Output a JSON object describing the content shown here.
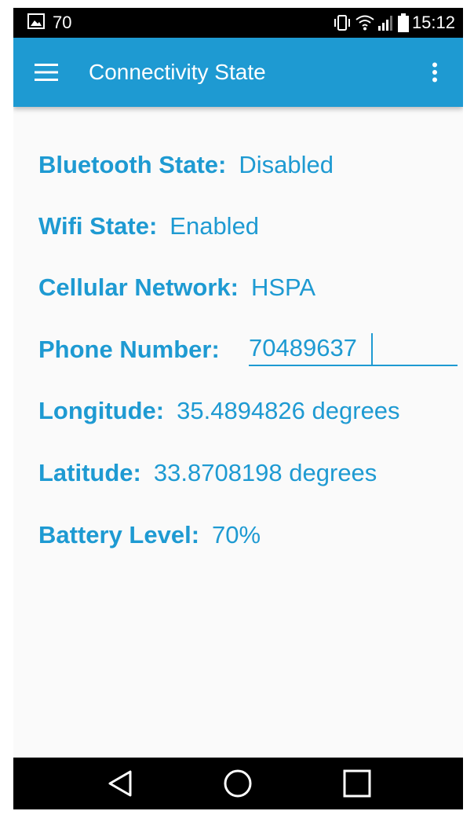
{
  "status_bar": {
    "notification_icon": "image-icon",
    "notification_count": "70",
    "icons": [
      "vibrate-icon",
      "wifi-icon",
      "signal-icon",
      "battery-icon"
    ],
    "time": "15:12"
  },
  "app_bar": {
    "menu_icon": "hamburger-menu-icon",
    "title": "Connectivity State",
    "overflow_icon": "more-vert-icon",
    "color": "#1e9ad2"
  },
  "fields": {
    "bluetooth": {
      "label": "Bluetooth State:",
      "value": "Disabled"
    },
    "wifi": {
      "label": "Wifi State:",
      "value": "Enabled"
    },
    "cellular": {
      "label": "Cellular Network:",
      "value": "HSPA"
    },
    "phone": {
      "label": "Phone Number:",
      "value": "70489637"
    },
    "longitude": {
      "label": "Longitude:",
      "value": "35.4894826 degrees"
    },
    "latitude": {
      "label": "Latitude:",
      "value": "33.8708198 degrees"
    },
    "battery": {
      "label": "Battery Level:",
      "value": "70%"
    }
  },
  "nav_bar": {
    "buttons": [
      "back-icon",
      "home-icon",
      "recents-icon"
    ]
  },
  "colors": {
    "accent": "#1e9ad2",
    "background": "#fafafa",
    "system_bars": "#000000"
  }
}
